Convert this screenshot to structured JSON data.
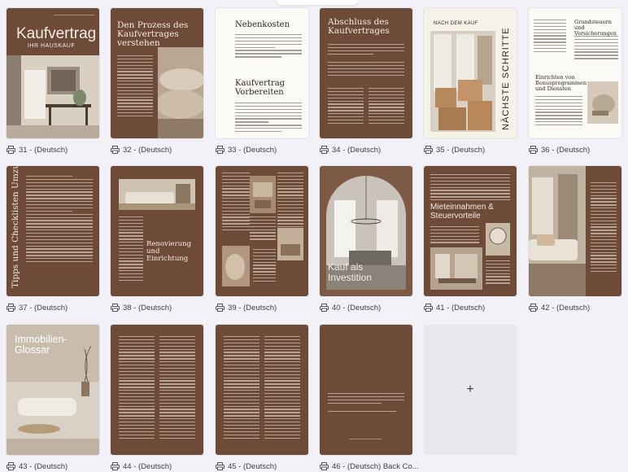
{
  "pages": [
    {
      "caption": "31 - (Deutsch)",
      "title": "Kaufvertrag",
      "subtitle": "IHR HAUSKAUF"
    },
    {
      "caption": "32 - (Deutsch)",
      "title": "Den Prozess des Kaufvertrages verstehen"
    },
    {
      "caption": "33 - (Deutsch)",
      "title": "Nebenkosten",
      "subtitle": "Kaufvertrag Vorbereiten"
    },
    {
      "caption": "34 - (Deutsch)",
      "title": "Abschluss des Kaufvertrages"
    },
    {
      "caption": "35 - (Deutsch)",
      "title": "NÄCHSTE SCHRITTE",
      "subtitle": "NACH DEM KAUF"
    },
    {
      "caption": "36 - (Deutsch)",
      "title": "Grundsteuern und Versicherungen",
      "subtitle": "Einrichten von Bonusprogrammen und Diensten"
    },
    {
      "caption": "37 - (Deutsch)",
      "title": "Tipps und Checklisten Umzug"
    },
    {
      "caption": "38 - (Deutsch)",
      "title": "Renovierung und Einrichtung"
    },
    {
      "caption": "39 - (Deutsch)"
    },
    {
      "caption": "40 - (Deutsch)",
      "title": "Kauf als Investition"
    },
    {
      "caption": "41 - (Deutsch)",
      "title": "Mieteinnahmen & Steuervorteile"
    },
    {
      "caption": "42 - (Deutsch)"
    },
    {
      "caption": "43 - (Deutsch)",
      "title": "Immobilien-Glossar"
    },
    {
      "caption": "44 - (Deutsch)"
    },
    {
      "caption": "45 - (Deutsch)"
    },
    {
      "caption": "46 - (Deutsch) Back Co..."
    }
  ],
  "add_page": {
    "label": "+"
  },
  "colors": {
    "brown": "#6e4a38",
    "cream": "#f6f2e8",
    "background": "#f1f1f7"
  },
  "icons": {
    "caption_icon": "printer-icon"
  }
}
